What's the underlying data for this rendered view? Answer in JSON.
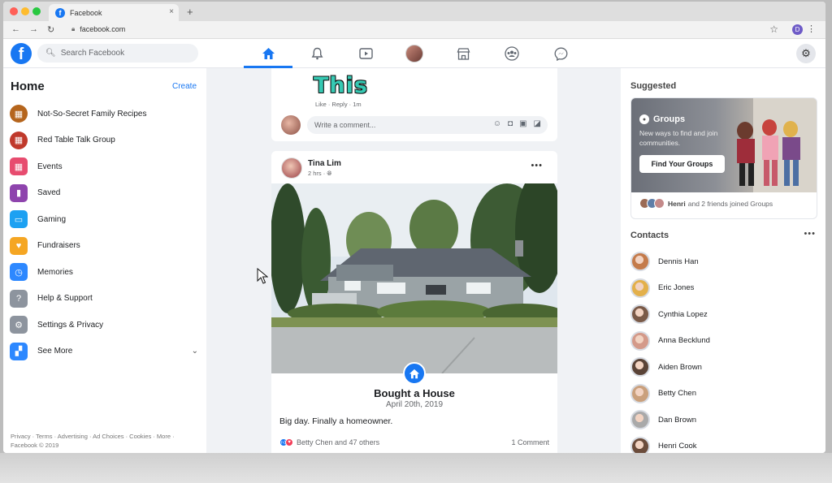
{
  "browser": {
    "tab_title": "Facebook",
    "tab_favicon": "f",
    "tab_close": "×",
    "new_tab": "+",
    "url": "facebook.com",
    "profile_initial": "D"
  },
  "header": {
    "logo": "f",
    "search_placeholder": "Search Facebook",
    "nav": [
      "home-icon",
      "bell-icon",
      "watch-icon",
      "profile-avatar",
      "marketplace-icon",
      "groups-icon",
      "messenger-icon"
    ]
  },
  "left": {
    "title": "Home",
    "create": "Create",
    "items": [
      {
        "label": "Not-So-Secret Family Recipes",
        "icon": "group-photo-icon",
        "color": "#b5651d"
      },
      {
        "label": "Red Table Talk Group",
        "icon": "group-photo-icon",
        "color": "#c0392b"
      },
      {
        "label": "Events",
        "icon": "calendar-icon",
        "color": "#e74c6f"
      },
      {
        "label": "Saved",
        "icon": "bookmark-icon",
        "color": "#8e44ad"
      },
      {
        "label": "Gaming",
        "icon": "gaming-icon",
        "color": "#1da1f2"
      },
      {
        "label": "Fundraisers",
        "icon": "heart-icon",
        "color": "#f5a623"
      },
      {
        "label": "Memories",
        "icon": "clock-icon",
        "color": "#2d88ff"
      },
      {
        "label": "Help & Support",
        "icon": "question-icon",
        "color": "#8d949e"
      },
      {
        "label": "Settings & Privacy",
        "icon": "gear-icon",
        "color": "#8d949e"
      },
      {
        "label": "See More",
        "icon": "grid-icon",
        "color": "#2d88ff"
      }
    ],
    "footer": "Privacy · Terms · Advertising · Ad Choices · Cookies · More · Facebook © 2019"
  },
  "feed": {
    "sticker_text": "This",
    "like_reply": "Like · Reply · 1m",
    "comment_placeholder": "Write a comment...",
    "post": {
      "author": "Tina Lim",
      "time": "2 hrs · ",
      "event_title": "Bought a House",
      "event_date": "April 20th, 2019",
      "text": "Big day. Finally a homeowner.",
      "reactions": "Betty Chen and 47 others",
      "comments": "1 Comment"
    }
  },
  "right": {
    "suggested": "Suggested",
    "groups": {
      "title": "Groups",
      "desc": "New ways to find and join communities.",
      "button": "Find Your Groups",
      "friends_name": "Henri",
      "friends_text": "and 2 friends joined Groups"
    },
    "contacts_title": "Contacts",
    "contacts": [
      {
        "name": "Dennis Han",
        "color": "#c47b4b"
      },
      {
        "name": "Eric Jones",
        "color": "#e3b04b"
      },
      {
        "name": "Cynthia Lopez",
        "color": "#7a5a48"
      },
      {
        "name": "Anna Becklund",
        "color": "#d49a8a"
      },
      {
        "name": "Aiden Brown",
        "color": "#5a4337"
      },
      {
        "name": "Betty Chen",
        "color": "#caa07c"
      },
      {
        "name": "Dan Brown",
        "color": "#a9a9a9"
      },
      {
        "name": "Henri Cook",
        "color": "#6b4c3b"
      }
    ]
  }
}
